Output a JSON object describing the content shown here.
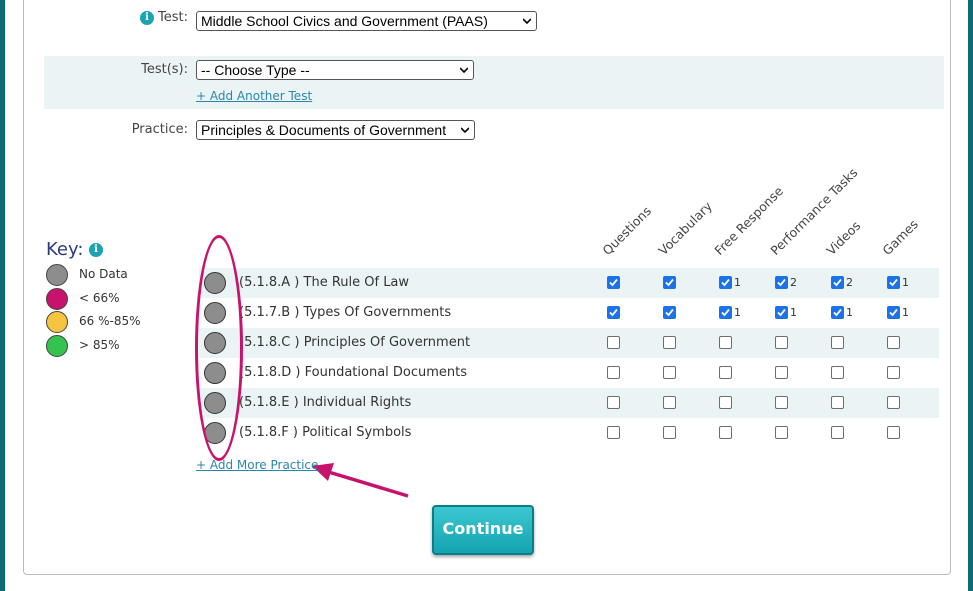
{
  "form": {
    "test_label": "Test:",
    "test_value": "Middle School Civics and Government (PAAS)",
    "tests_label": "Test(s):",
    "tests_value": "-- Choose Type --",
    "add_another_test": "+ Add Another Test",
    "practice_label": "Practice:",
    "practice_value": "Principles & Documents of Government"
  },
  "key": {
    "title": "Key:",
    "items": [
      {
        "label": "No Data",
        "color": "#8d8d8d"
      },
      {
        "label": "< 66%",
        "color": "#c8136d"
      },
      {
        "label": "66 %-85%",
        "color": "#f5c542"
      },
      {
        "label": "> 85%",
        "color": "#34c34f"
      }
    ]
  },
  "columns": [
    "Questions",
    "Vocabulary",
    "Free Response",
    "Performance Tasks",
    "Videos",
    "Games"
  ],
  "rows": [
    {
      "label": "(5.1.8.A ) The Rule Of Law",
      "checks": [
        true,
        true,
        true,
        true,
        true,
        true
      ],
      "counts": [
        "",
        "",
        "1",
        "2",
        "2",
        "1"
      ]
    },
    {
      "label": "(5.1.7.B ) Types Of Governments",
      "checks": [
        true,
        true,
        true,
        true,
        true,
        true
      ],
      "counts": [
        "",
        "",
        "1",
        "1",
        "1",
        "1"
      ]
    },
    {
      "label": "(5.1.8.C ) Principles Of Government",
      "checks": [
        false,
        false,
        false,
        false,
        false,
        false
      ],
      "counts": [
        "",
        "",
        "",
        "",
        "",
        ""
      ]
    },
    {
      "label": "(5.1.8.D ) Foundational Documents",
      "checks": [
        false,
        false,
        false,
        false,
        false,
        false
      ],
      "counts": [
        "",
        "",
        "",
        "",
        "",
        ""
      ]
    },
    {
      "label": "(5.1.8.E ) Individual Rights",
      "checks": [
        false,
        false,
        false,
        false,
        false,
        false
      ],
      "counts": [
        "",
        "",
        "",
        "",
        "",
        ""
      ]
    },
    {
      "label": "(5.1.8.F ) Political Symbols",
      "checks": [
        false,
        false,
        false,
        false,
        false,
        false
      ],
      "counts": [
        "",
        "",
        "",
        "",
        "",
        ""
      ]
    }
  ],
  "add_more_practice": "+ Add More Practice",
  "continue_label": "Continue",
  "colors": {
    "accent": "#1aa3b4",
    "highlight": "#c8136d",
    "checkbox": "#1a73e8"
  }
}
